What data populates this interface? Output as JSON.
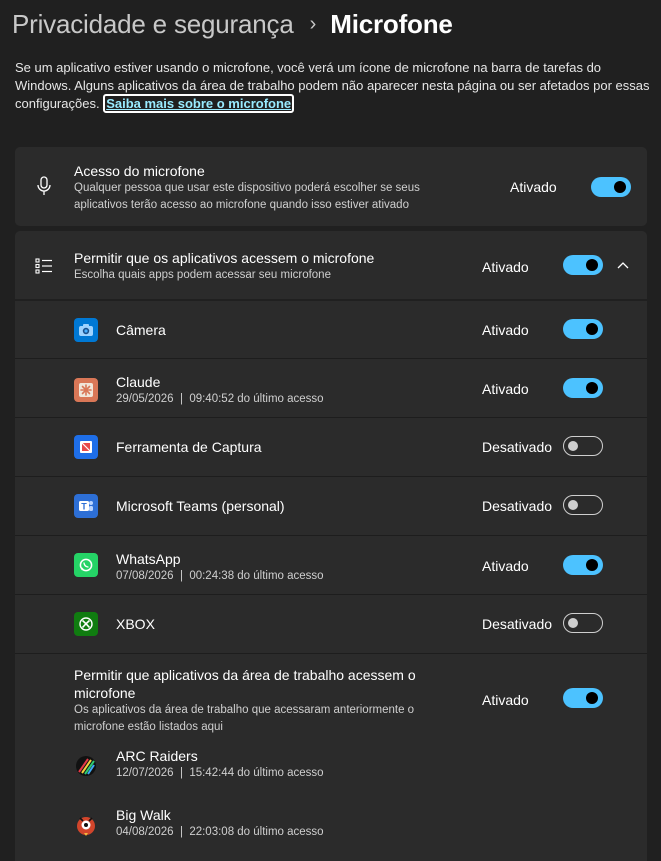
{
  "breadcrumb": {
    "parent": "Privacidade e segurança",
    "separator": "›",
    "current": "Microfone"
  },
  "description": {
    "text": "Se um aplicativo estiver usando o microfone, você verá um ícone de microfone na barra de tarefas do Windows. Alguns aplicativos da área de trabalho podem não aparecer nesta página ou ser afetados por essas configurações.",
    "link": "Saiba mais sobre o microfone"
  },
  "mic_access": {
    "icon": "microphone-icon",
    "title": "Acesso do microfone",
    "subtitle": "Qualquer pessoa que usar este dispositivo poderá escolher se seus aplicativos terão acesso ao microfone quando isso estiver ativado",
    "state": "Ativado",
    "enabled": true
  },
  "apps_access": {
    "icon": "list-icon",
    "title": "Permitir que os aplicativos acessem o microfone",
    "subtitle": "Escolha quais apps podem acessar seu microfone",
    "state": "Ativado",
    "enabled": true,
    "expanded": true
  },
  "apps": [
    {
      "name": "Câmera",
      "detail": "",
      "state": "Ativado",
      "enabled": true,
      "icon": "camera-app-icon",
      "color": "#0078d4"
    },
    {
      "name": "Claude",
      "detail": "29/05/2026  |  09:40:52 do último acesso",
      "state": "Ativado",
      "enabled": true,
      "icon": "claude-app-icon",
      "color": "#d97757"
    },
    {
      "name": "Ferramenta de Captura",
      "detail": "",
      "state": "Desativado",
      "enabled": false,
      "icon": "snipping-tool-icon",
      "color": "#1e6ee8"
    },
    {
      "name": "Microsoft Teams (personal)",
      "detail": "",
      "state": "Desativado",
      "enabled": false,
      "icon": "teams-app-icon",
      "color": "#2d6fd6"
    },
    {
      "name": "WhatsApp",
      "detail": "07/08/2026  |  00:24:38 do último acesso",
      "state": "Ativado",
      "enabled": true,
      "icon": "whatsapp-app-icon",
      "color": "#25d366"
    },
    {
      "name": "XBOX",
      "detail": "",
      "state": "Desativado",
      "enabled": false,
      "icon": "xbox-app-icon",
      "color": "#107c10"
    }
  ],
  "desktop_access": {
    "title": "Permitir que aplicativos da área de trabalho acessem o microfone",
    "subtitle": "Os aplicativos da área de trabalho que acessaram anteriormente o microfone estão listados aqui",
    "state": "Ativado",
    "enabled": true
  },
  "desktop_apps": [
    {
      "name": "ARC Raiders",
      "detail": "12/07/2026  |  15:42:44 do último acesso",
      "icon": "arc-raiders-icon"
    },
    {
      "name": "Big Walk",
      "detail": "04/08/2026  |  22:03:08 do último acesso",
      "icon": "big-walk-icon"
    }
  ]
}
